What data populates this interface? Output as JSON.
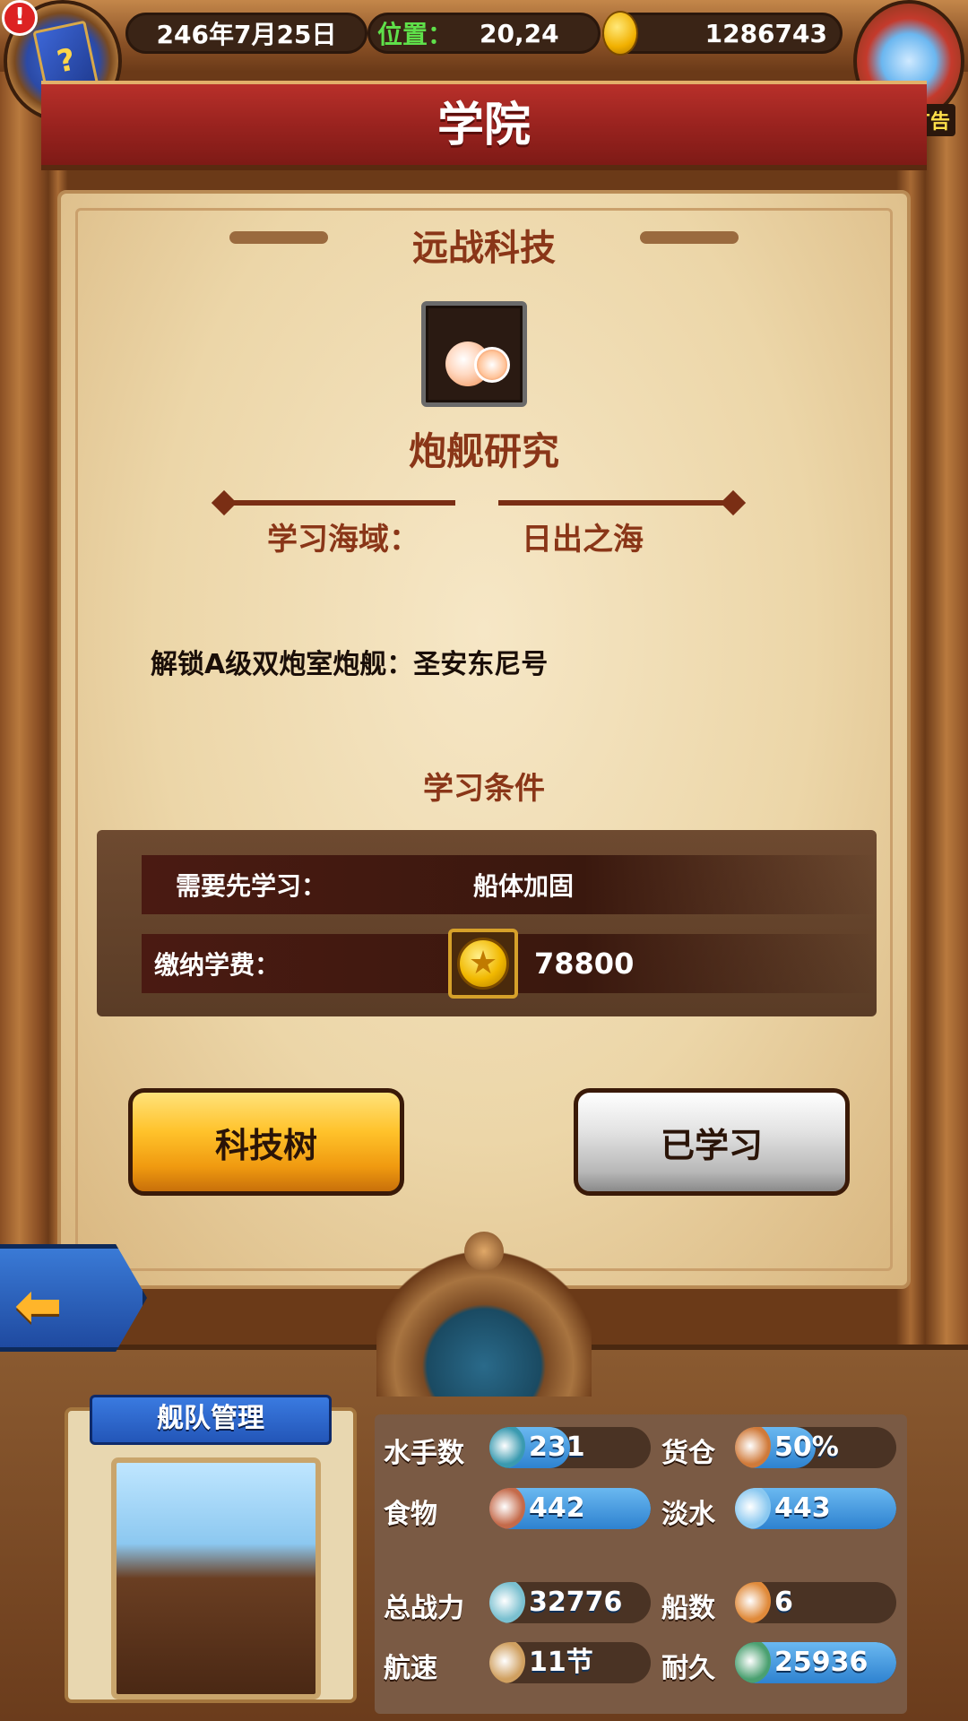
{
  "header": {
    "date": "246年7月25日",
    "position_label": "位置：",
    "position_value": "20,24",
    "gold": "1286743",
    "alert_mark": "!",
    "ad_label": "有新广告"
  },
  "title": "学院",
  "tech": {
    "category": "远战科技",
    "name": "炮舰研究",
    "study_area_label": "学习海域：",
    "study_area_value": "日出之海",
    "unlock_text": "解锁A级双炮室炮舰：圣安东尼号"
  },
  "conditions": {
    "title": "学习条件",
    "prereq_label": "需要先学习：",
    "prereq_value": "船体加固",
    "fee_label": "缴纳学费：",
    "fee_value": "78800"
  },
  "buttons": {
    "tech_tree": "科技树",
    "learned": "已学习",
    "back_arrow": "⬅"
  },
  "fleet": {
    "title": "舰队管理",
    "stats": [
      {
        "label": "水手数",
        "value": "231",
        "fill": 0.5,
        "icon": "sailor-icon",
        "color": "#3a9ab0"
      },
      {
        "label": "货仓",
        "value": "50%",
        "fill": 0.5,
        "icon": "crate-icon",
        "color": "#d07a3a"
      },
      {
        "label": "食物",
        "value": "442",
        "fill": 1.0,
        "icon": "meat-icon",
        "color": "#c46a4a"
      },
      {
        "label": "淡水",
        "value": "443",
        "fill": 1.0,
        "icon": "water-jug-icon",
        "color": "#8ac8f0"
      },
      {
        "label": "总战力",
        "value": "32776",
        "fill": 0.0,
        "icon": "crossed-swords-icon",
        "color": "#7ac0d0"
      },
      {
        "label": "船数",
        "value": "6",
        "fill": 0.0,
        "icon": "ship-icon",
        "color": "#e08a3a"
      },
      {
        "label": "航速",
        "value": "11节",
        "fill": 0.0,
        "icon": "sail-boat-icon",
        "color": "#d0a060"
      },
      {
        "label": "耐久",
        "value": "25936",
        "fill": 1.0,
        "icon": "repair-ship-icon",
        "color": "#4aa070"
      }
    ]
  }
}
